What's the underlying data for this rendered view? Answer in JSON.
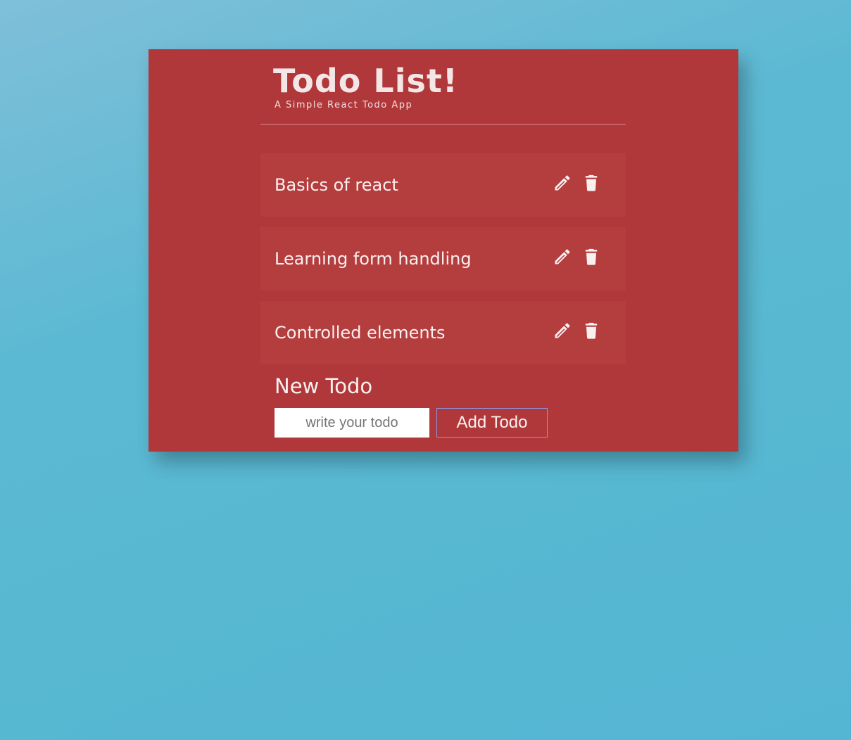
{
  "header": {
    "title": "Todo List!",
    "subtitle": "A Simple React Todo App"
  },
  "todos": [
    {
      "text": "Basics of react",
      "edit_icon": "pencil-icon",
      "delete_icon": "trash-icon"
    },
    {
      "text": "Learning form handling",
      "edit_icon": "pencil-icon",
      "delete_icon": "trash-icon"
    },
    {
      "text": "Controlled elements",
      "edit_icon": "pencil-icon",
      "delete_icon": "trash-icon"
    }
  ],
  "new_todo": {
    "label": "New Todo",
    "input_value": "",
    "input_placeholder": "write your todo",
    "add_button_label": "Add Todo"
  },
  "colors": {
    "card_background": "#b0383a",
    "todo_item_background": "#b43d3e",
    "page_background": "#58b8d2",
    "text": "#fbf0f0",
    "button_border": "#8a9ae6"
  }
}
